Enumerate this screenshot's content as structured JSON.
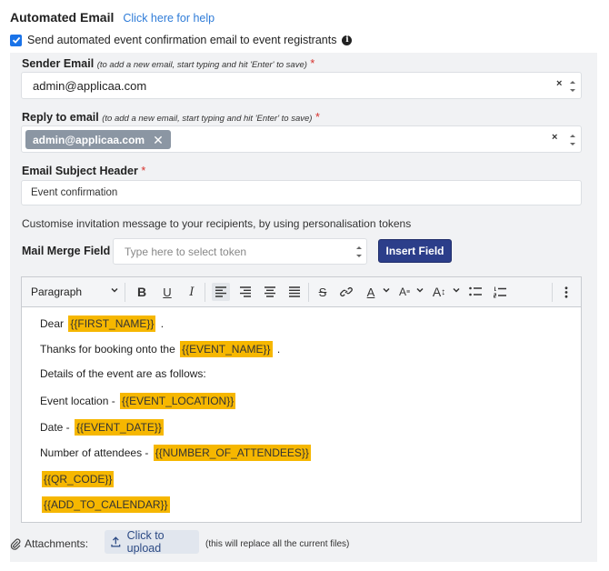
{
  "header": {
    "title": "Automated Email",
    "help_link": "Click here for help"
  },
  "confirmation": {
    "checked": true,
    "label": "Send automated event confirmation email to event registrants"
  },
  "sender_email": {
    "label": "Sender Email",
    "hint": "(to add a new email, start typing and hit 'Enter' to save)",
    "required_mark": "*",
    "value": "admin@applicaa.com",
    "clear_glyph": "×"
  },
  "reply_to": {
    "label": "Reply to email",
    "hint": "(to add a new email, start typing and hit 'Enter' to save)",
    "required_mark": "*",
    "tag": "admin@applicaa.com",
    "clear_glyph": "×"
  },
  "subject": {
    "label": "Email Subject Header",
    "required_mark": "*",
    "value": "Event confirmation"
  },
  "customise_text": "Customise invitation message to your recipients, by using personalisation tokens",
  "mail_merge": {
    "label": "Mail Merge Field",
    "placeholder": "Type here to select token",
    "insert_button": "Insert Field"
  },
  "toolbar": {
    "paragraph": "Paragraph",
    "tools": [
      "bold-icon",
      "underline-icon",
      "italic-icon",
      "align-left-icon",
      "align-right-icon",
      "align-center-icon",
      "align-justify-icon",
      "strikethrough-icon",
      "link-icon",
      "font-color-icon",
      "text-style-icon",
      "font-size-icon",
      "bullet-list-icon",
      "numbered-list-icon",
      "more-icon"
    ]
  },
  "editor": {
    "lines": [
      {
        "before": "Dear ",
        "token": "{{FIRST_NAME}}",
        "after": " ."
      },
      {
        "before": "Thanks for booking onto the ",
        "token": "{{EVENT_NAME}}",
        "after": " ."
      },
      {
        "before": "Details of the event are as follows:",
        "token": "",
        "after": ""
      },
      {
        "before": "Event location - ",
        "token": "{{EVENT_LOCATION}}",
        "after": ""
      },
      {
        "before": "Date - ",
        "token": "{{EVENT_DATE}}",
        "after": ""
      },
      {
        "before": "Number of attendees - ",
        "token": "{{NUMBER_OF_ATTENDEES}}",
        "after": ""
      },
      {
        "before": "",
        "token": "{{QR_CODE}}",
        "after": ""
      },
      {
        "before": "",
        "token": "{{ADD_TO_CALENDAR}}",
        "after": ""
      }
    ]
  },
  "attachments": {
    "label": "Attachments:",
    "upload_button": "Click to upload",
    "note": "(this will replace all the current files)"
  },
  "colors": {
    "accent": "#2f7cd8",
    "button": "#2c3e8a",
    "token": "#f6b700",
    "panel": "#f1f2f4"
  }
}
